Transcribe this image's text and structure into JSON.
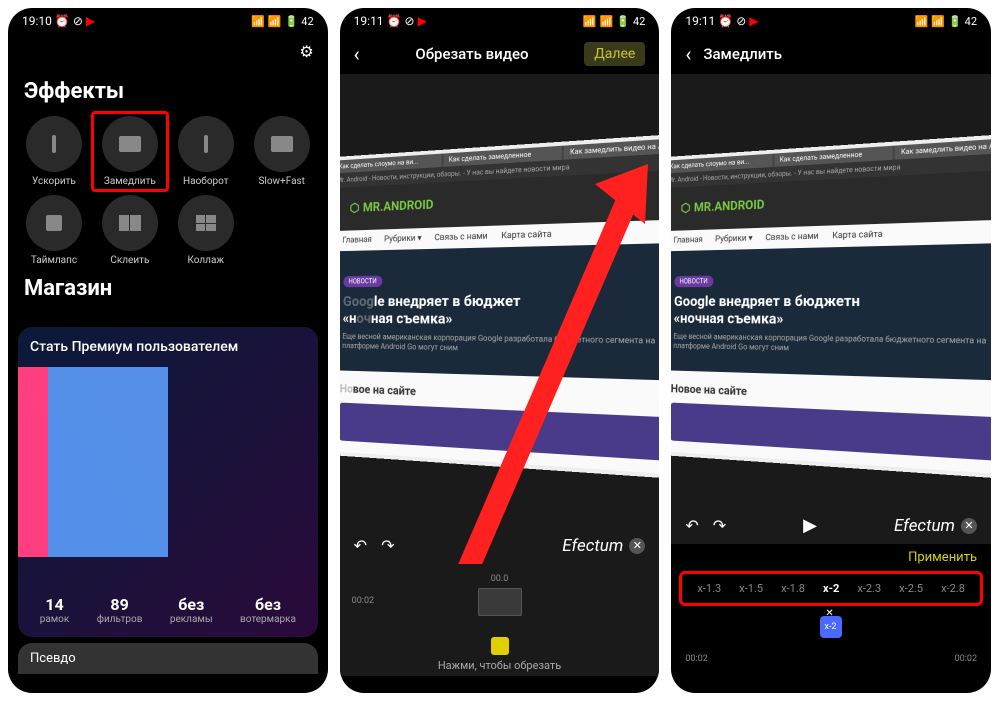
{
  "statusbar": {
    "time1": "19:10",
    "time2": "19:11",
    "battery": "42"
  },
  "screen1": {
    "effects_title": "Эффекты",
    "effects": [
      {
        "label": "Ускорить"
      },
      {
        "label": "Замедлить"
      },
      {
        "label": "Наоборот"
      },
      {
        "label": "Slow+Fast"
      },
      {
        "label": "Таймлапс"
      },
      {
        "label": "Склеить"
      },
      {
        "label": "Коллаж"
      }
    ],
    "store_title": "Магазин",
    "premium": "Стать Премиум пользователем",
    "stats": [
      {
        "num": "14",
        "lbl": "рамок"
      },
      {
        "num": "89",
        "lbl": "фильтров"
      },
      {
        "num": "без",
        "lbl": "рекламы"
      },
      {
        "num": "без",
        "lbl": "вотермарка"
      }
    ],
    "pseudo": "Псевдо"
  },
  "screen2": {
    "title": "Обрезать видео",
    "next": "Далее",
    "watermark": "Efectum",
    "tl_center": "00.0",
    "tl_left": "00:02",
    "hint": "Нажми, чтобы обрезать"
  },
  "screen3": {
    "title": "Замедлить",
    "watermark": "Efectum",
    "apply": "Применить",
    "speeds": [
      "x-1.3",
      "x-1.5",
      "x-1.8",
      "x-2",
      "x-2.3",
      "x-2.5",
      "x-2.8"
    ],
    "active_speed": "x-2",
    "tl_left": "00:02",
    "tl_right": "00:02"
  },
  "web": {
    "tabs": [
      "Как сделать слоумо на ви...",
      "Как сделать замедленное",
      "Как замедлить видео на А..."
    ],
    "infobar": "Mr. Android - Новости, инструкции, обзоры. - У нас вы найдете новости мира",
    "logo": "MR.ANDROID",
    "nav": [
      "Главная",
      "Рубрики ▾",
      "Связь с нами",
      "Карта сайта"
    ],
    "badge": "НОВОСТИ",
    "hero_title_a": "Google внедряет в бюджетн",
    "hero_title_b": "«ночная съемка»",
    "hero_sub": "Еще весной американская корпорация Google разработала бюджетного сегмента на платформе Android Go могут сним",
    "section": "Новое на сайте"
  }
}
